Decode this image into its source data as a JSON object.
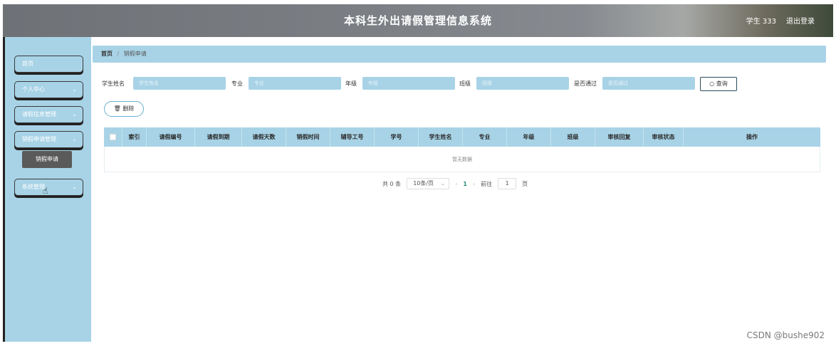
{
  "header": {
    "title": "本科生外出请假管理信息系统",
    "user_label": "学生 333",
    "logout_label": "退出登录"
  },
  "sidebar": {
    "items": [
      {
        "label": "首页"
      },
      {
        "label": "个人中心"
      },
      {
        "label": "请假信息管理"
      },
      {
        "label": "销假申请管理"
      },
      {
        "label": "系统管理"
      }
    ],
    "submenu_label": "销假申请"
  },
  "breadcrumb": {
    "home": "首页",
    "current": "销假申请"
  },
  "filters": {
    "student_name_label": "学生姓名",
    "student_name_placeholder": "学生姓名",
    "major_label": "专业",
    "major_placeholder": "专业",
    "grade_label": "年级",
    "grade_placeholder": "年级",
    "class_label": "班级",
    "class_placeholder": "班级",
    "passed_label": "是否通过",
    "passed_placeholder": "是否通过",
    "search_label": "查询"
  },
  "actions": {
    "delete_label": "删除"
  },
  "table": {
    "columns": [
      "索引",
      "请假编号",
      "请假到期",
      "请假天数",
      "销假时间",
      "辅导工号",
      "学号",
      "学生姓名",
      "专业",
      "年级",
      "班级",
      "审核回复",
      "审核状态",
      "操作"
    ],
    "empty_text": "暂无数据"
  },
  "pagination": {
    "total": "共 0 条",
    "page_size": "10条/页",
    "current_page": "1",
    "goto_label": "前往",
    "goto_value": "1",
    "page_suffix": "页"
  },
  "watermark": "CSDN @bushe902"
}
